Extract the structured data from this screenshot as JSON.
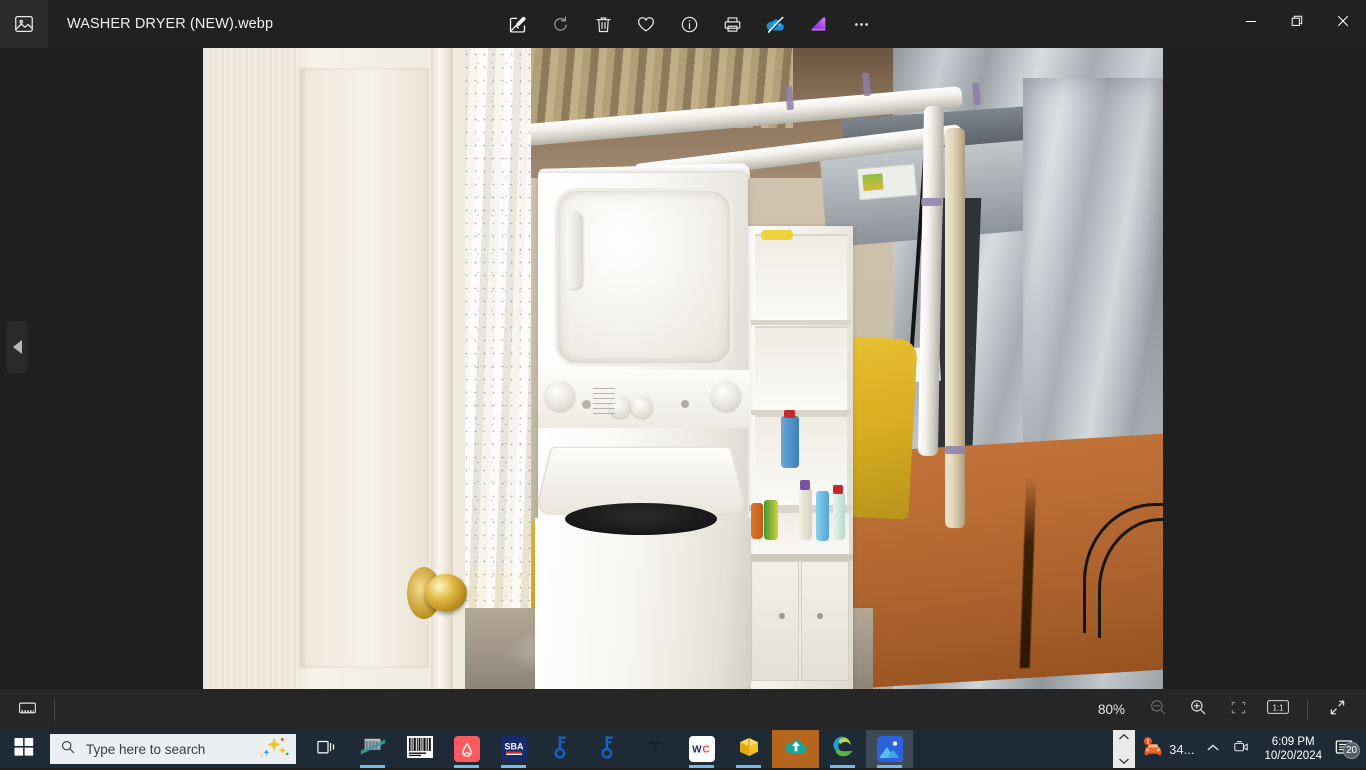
{
  "window": {
    "app_icon": "photo-icon",
    "title": "WASHER DRYER (NEW).webp",
    "controls": {
      "minimize": "minimize-icon",
      "restore": "restore-icon",
      "close": "close-icon"
    }
  },
  "toolbar": {
    "items": [
      {
        "name": "edit-image-button",
        "icon": "edit-image-icon",
        "label": "Edit image"
      },
      {
        "name": "rotate-button",
        "icon": "rotate-icon",
        "label": "Rotate"
      },
      {
        "name": "delete-button",
        "icon": "trash-icon",
        "label": "Delete"
      },
      {
        "name": "favorite-button",
        "icon": "heart-icon",
        "label": "Add to favorites"
      },
      {
        "name": "info-button",
        "icon": "info-icon",
        "label": "File info"
      },
      {
        "name": "print-button",
        "icon": "print-icon",
        "label": "Print"
      },
      {
        "name": "onedrive-button",
        "icon": "cloud-slash-icon",
        "label": "OneDrive"
      },
      {
        "name": "designer-button",
        "icon": "designer-icon",
        "label": "Designer"
      },
      {
        "name": "more-options-button",
        "icon": "ellipsis-icon",
        "label": "See more"
      }
    ]
  },
  "viewer": {
    "prev_button": "previous-image-arrow",
    "photo_alt": "WASHER DRYER (NEW)"
  },
  "bottom_bar": {
    "filmstrip": "filmstrip-icon",
    "zoom_level": "80%",
    "zoom_out": "zoom-out-icon",
    "zoom_in": "zoom-in-icon",
    "fit_to_window": "fit-to-window-icon",
    "actual_size": "1:1",
    "fullscreen": "fullscreen-icon"
  },
  "taskbar": {
    "start": "windows-start-icon",
    "search": {
      "placeholder": "Type here to search",
      "icon": "search-icon",
      "copilot_icon": "sparkle-icon"
    },
    "apps": [
      {
        "name": "task-view-button",
        "icon": "task-view-icon"
      },
      {
        "name": "bank-app",
        "icon": "bank-icon"
      },
      {
        "name": "barcode-app",
        "icon": "barcode-icon"
      },
      {
        "name": "airbnb-app",
        "icon": "airbnb-icon",
        "label": ""
      },
      {
        "name": "sba-app",
        "icon": "sba-icon",
        "label": "SBA"
      },
      {
        "name": "key-app-1",
        "icon": "key-icon"
      },
      {
        "name": "key-app-2",
        "icon": "key-icon"
      },
      {
        "name": "filter-app",
        "icon": "funnel-icon"
      },
      {
        "name": "wc-app",
        "icon": "wc-tile-icon",
        "label": "WC"
      },
      {
        "name": "package-app",
        "icon": "box-icon"
      },
      {
        "name": "cloud-upload-app",
        "icon": "cloud-upload-icon"
      },
      {
        "name": "edge-browser",
        "icon": "edge-icon"
      },
      {
        "name": "photos-app",
        "icon": "photos-icon"
      }
    ],
    "tray": {
      "scroll": "scroll-chevrons",
      "car_alert_text": "34...",
      "car_alert_icon": "car-alert-icon",
      "show_hidden": "chevron-up-icon",
      "camera_icon": "camera-icon",
      "time": "6:09 PM",
      "date": "10/20/2024",
      "notification_icon": "notification-icon",
      "notification_count": "20"
    }
  },
  "colors": {
    "titlebar_bg": "#212121",
    "window_bg": "#1f1f1f",
    "bottombar_bg": "#262626",
    "taskbar_bg": "#1e2a35",
    "search_bg": "#eceff1",
    "accent_highlight": "#b5651d",
    "underline": "#76b9ed",
    "close_hover": "#c42b1c"
  }
}
